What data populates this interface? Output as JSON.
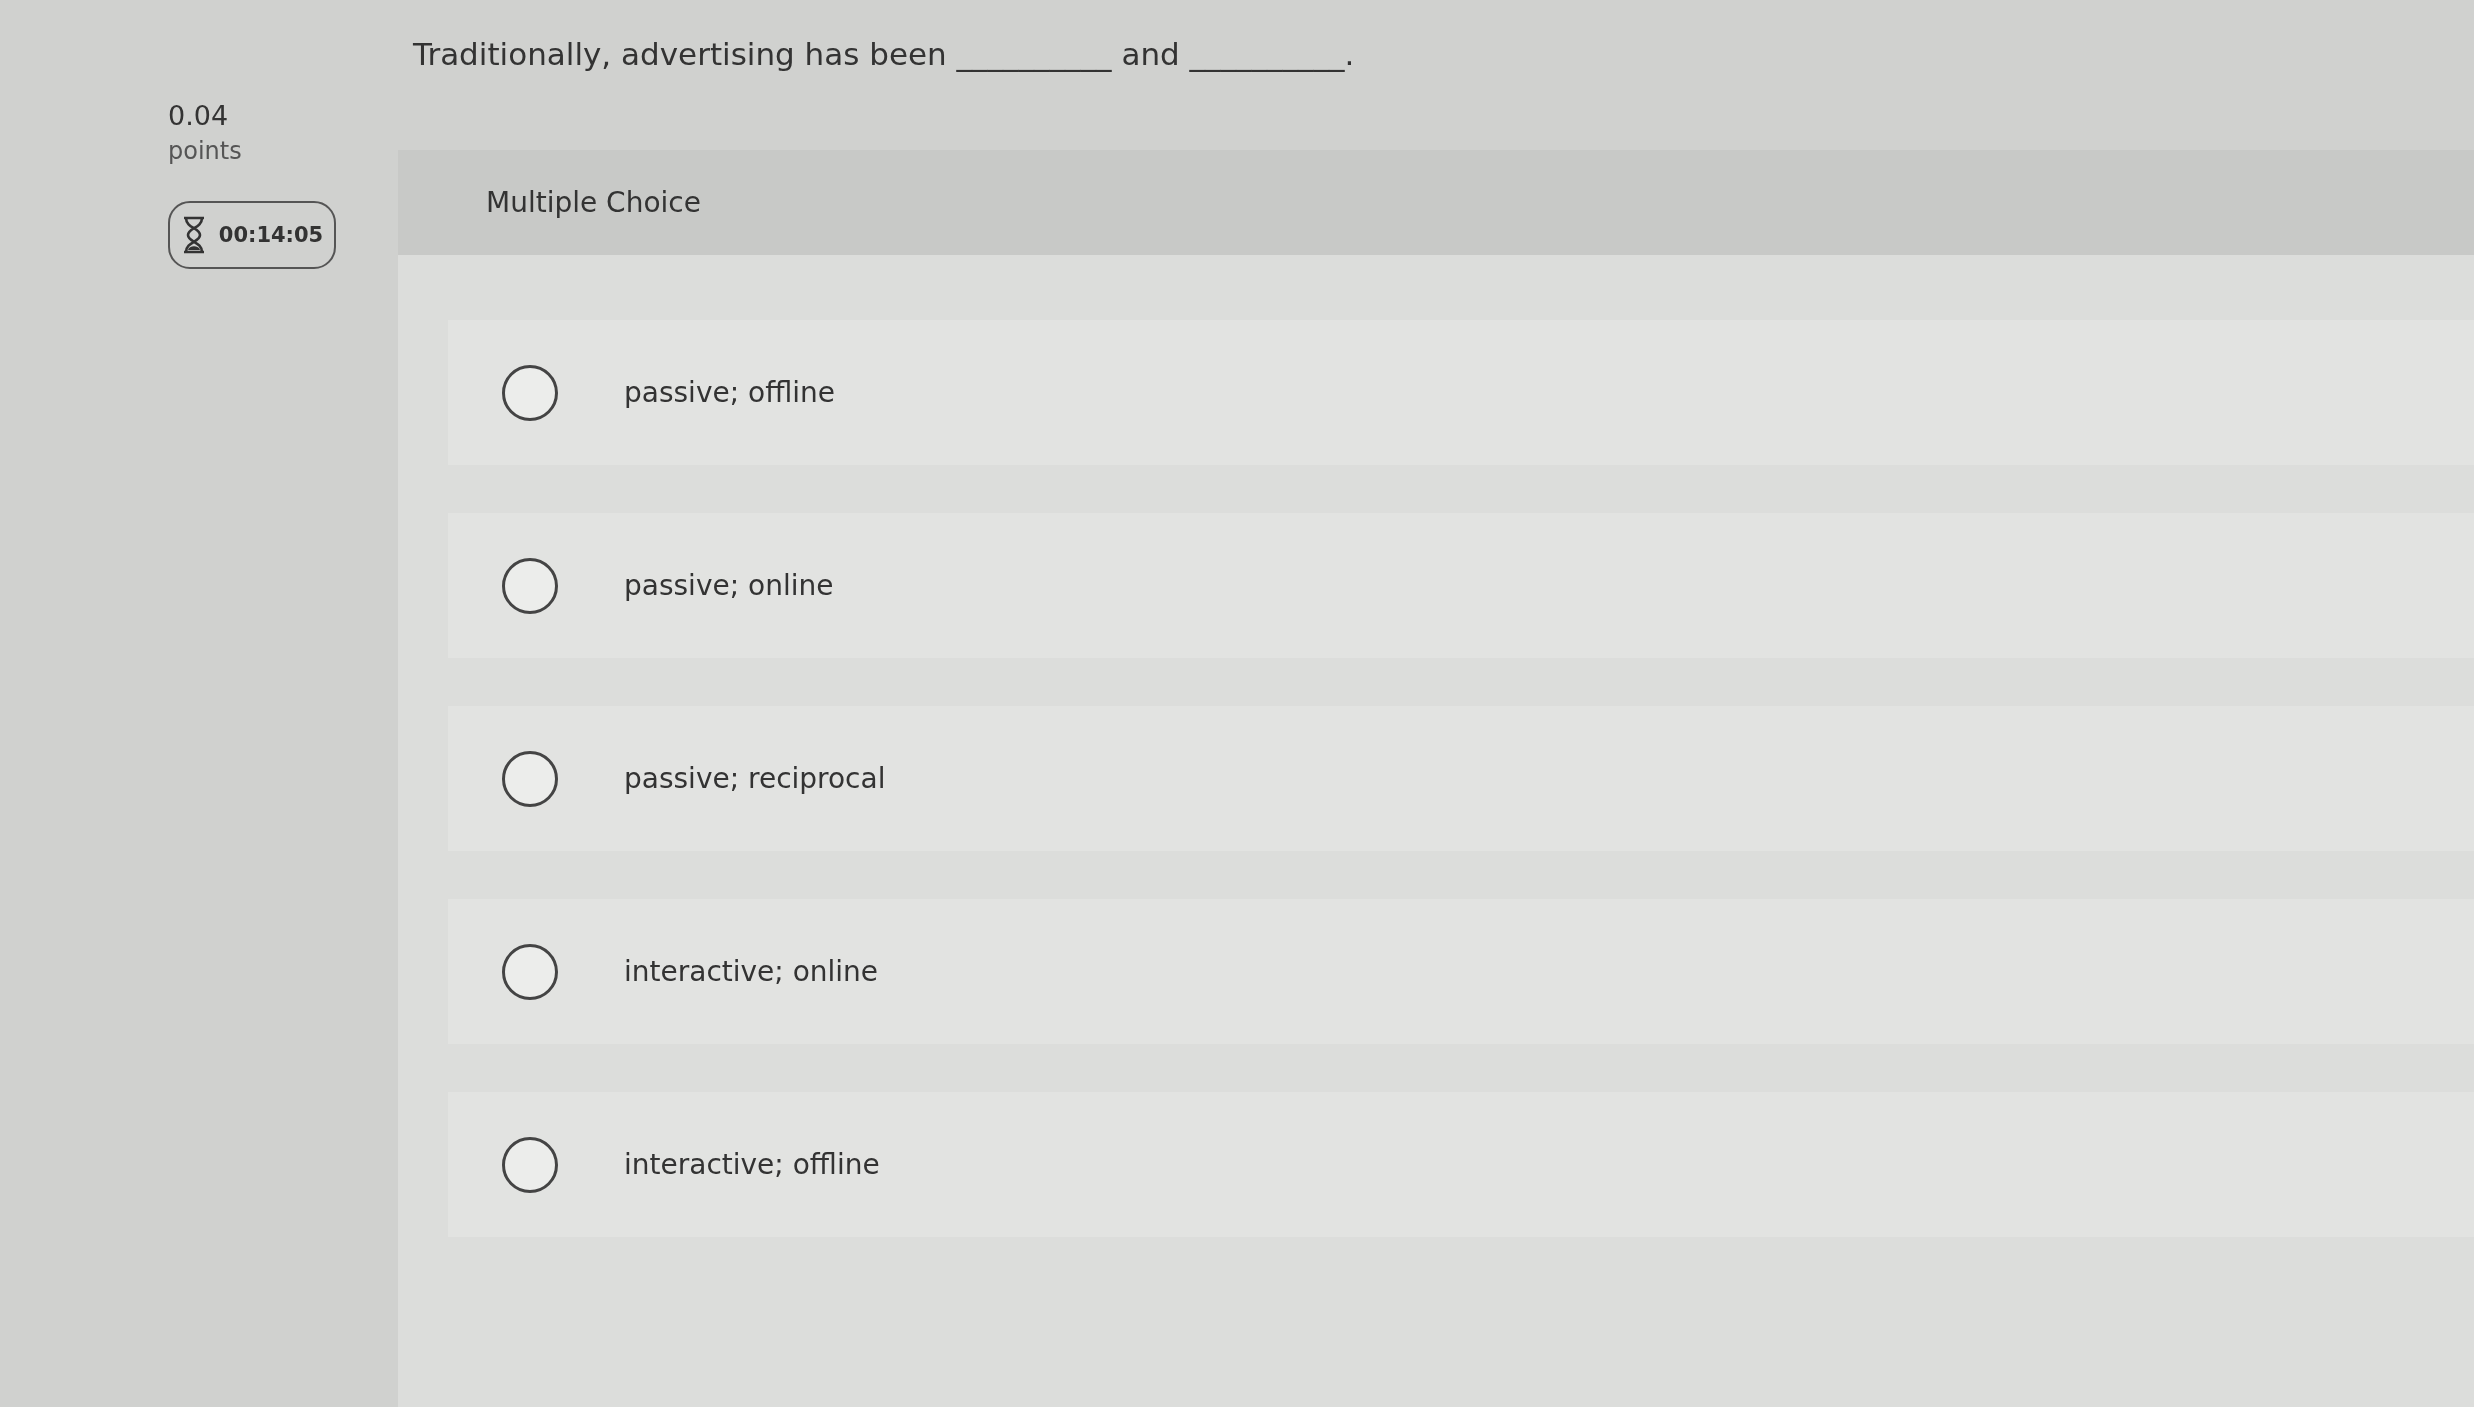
{
  "question": "Traditionally, advertising has been __________ and __________.",
  "points": {
    "value": "0.04",
    "label": "points"
  },
  "timer": "00:14:05",
  "question_type": "Multiple Choice",
  "options": [
    {
      "label": "passive; offline",
      "selected": false
    },
    {
      "label": "passive; online",
      "selected": false
    },
    {
      "label": "passive; reciprocal",
      "selected": false
    },
    {
      "label": "interactive; online",
      "selected": false
    },
    {
      "label": "interactive; offline",
      "selected": false
    }
  ]
}
